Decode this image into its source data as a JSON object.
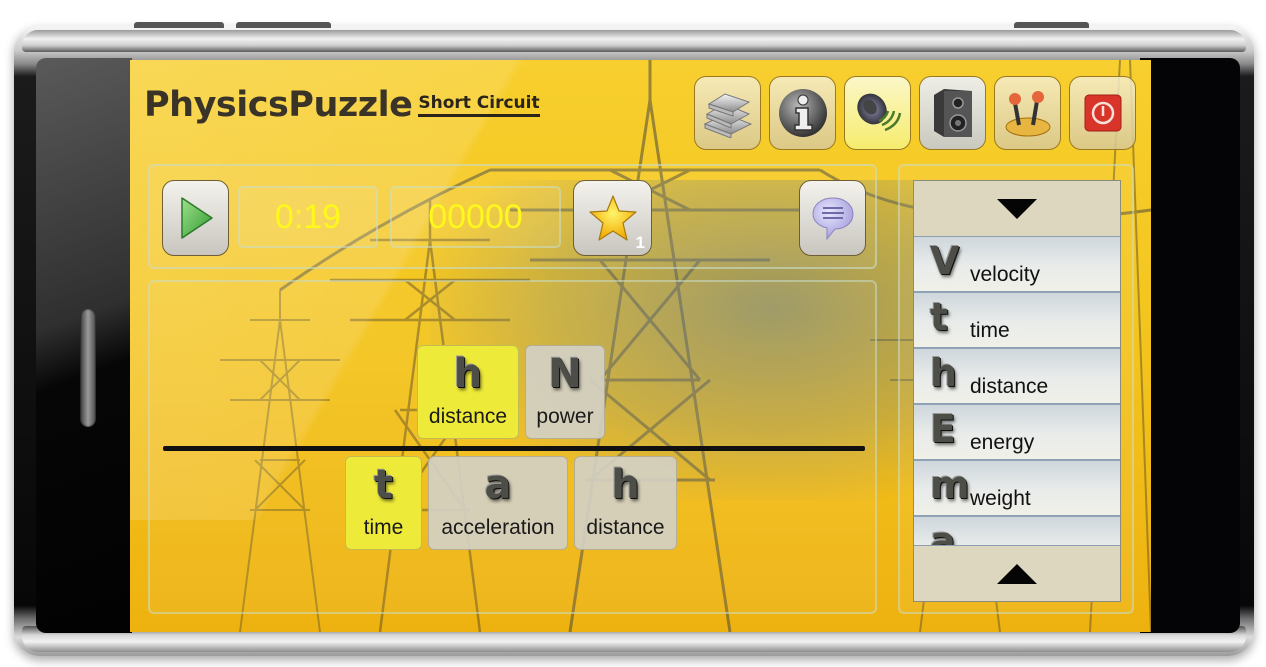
{
  "app": {
    "title": "PhysicsPuzzle",
    "subtitle": "Short Circuit"
  },
  "toolbar": {
    "buttons": [
      {
        "name": "library",
        "icon": "books-icon"
      },
      {
        "name": "info",
        "icon": "info-icon"
      },
      {
        "name": "sound",
        "icon": "sound-on-icon",
        "active": true
      },
      {
        "name": "music",
        "icon": "speaker-icon"
      },
      {
        "name": "controls",
        "icon": "joystick-icon"
      },
      {
        "name": "exit",
        "icon": "power-icon"
      }
    ]
  },
  "status": {
    "timer": "0:19",
    "score": "00000",
    "stars": "1"
  },
  "equation": {
    "numerator": [
      {
        "symbol": "h",
        "label": "distance",
        "selected": true
      },
      {
        "symbol": "N",
        "label": "power",
        "selected": false
      }
    ],
    "denominator": [
      {
        "symbol": "t",
        "label": "time",
        "selected": true
      },
      {
        "symbol": "a",
        "label": "acceleration",
        "selected": false
      },
      {
        "symbol": "h",
        "label": "distance",
        "selected": false
      }
    ]
  },
  "symbol_list": {
    "items": [
      {
        "symbol": "V",
        "label": "velocity"
      },
      {
        "symbol": "t",
        "label": "time"
      },
      {
        "symbol": "h",
        "label": "distance"
      },
      {
        "symbol": "E",
        "label": "energy"
      },
      {
        "symbol": "m",
        "label": "weight"
      },
      {
        "symbol": "a",
        "label": ""
      }
    ]
  },
  "colors": {
    "background_yellow": "#f4c41d",
    "readout_text": "#fff81c",
    "tile_selected": "#eeea3a",
    "tile_default": "#d2d0c4"
  }
}
